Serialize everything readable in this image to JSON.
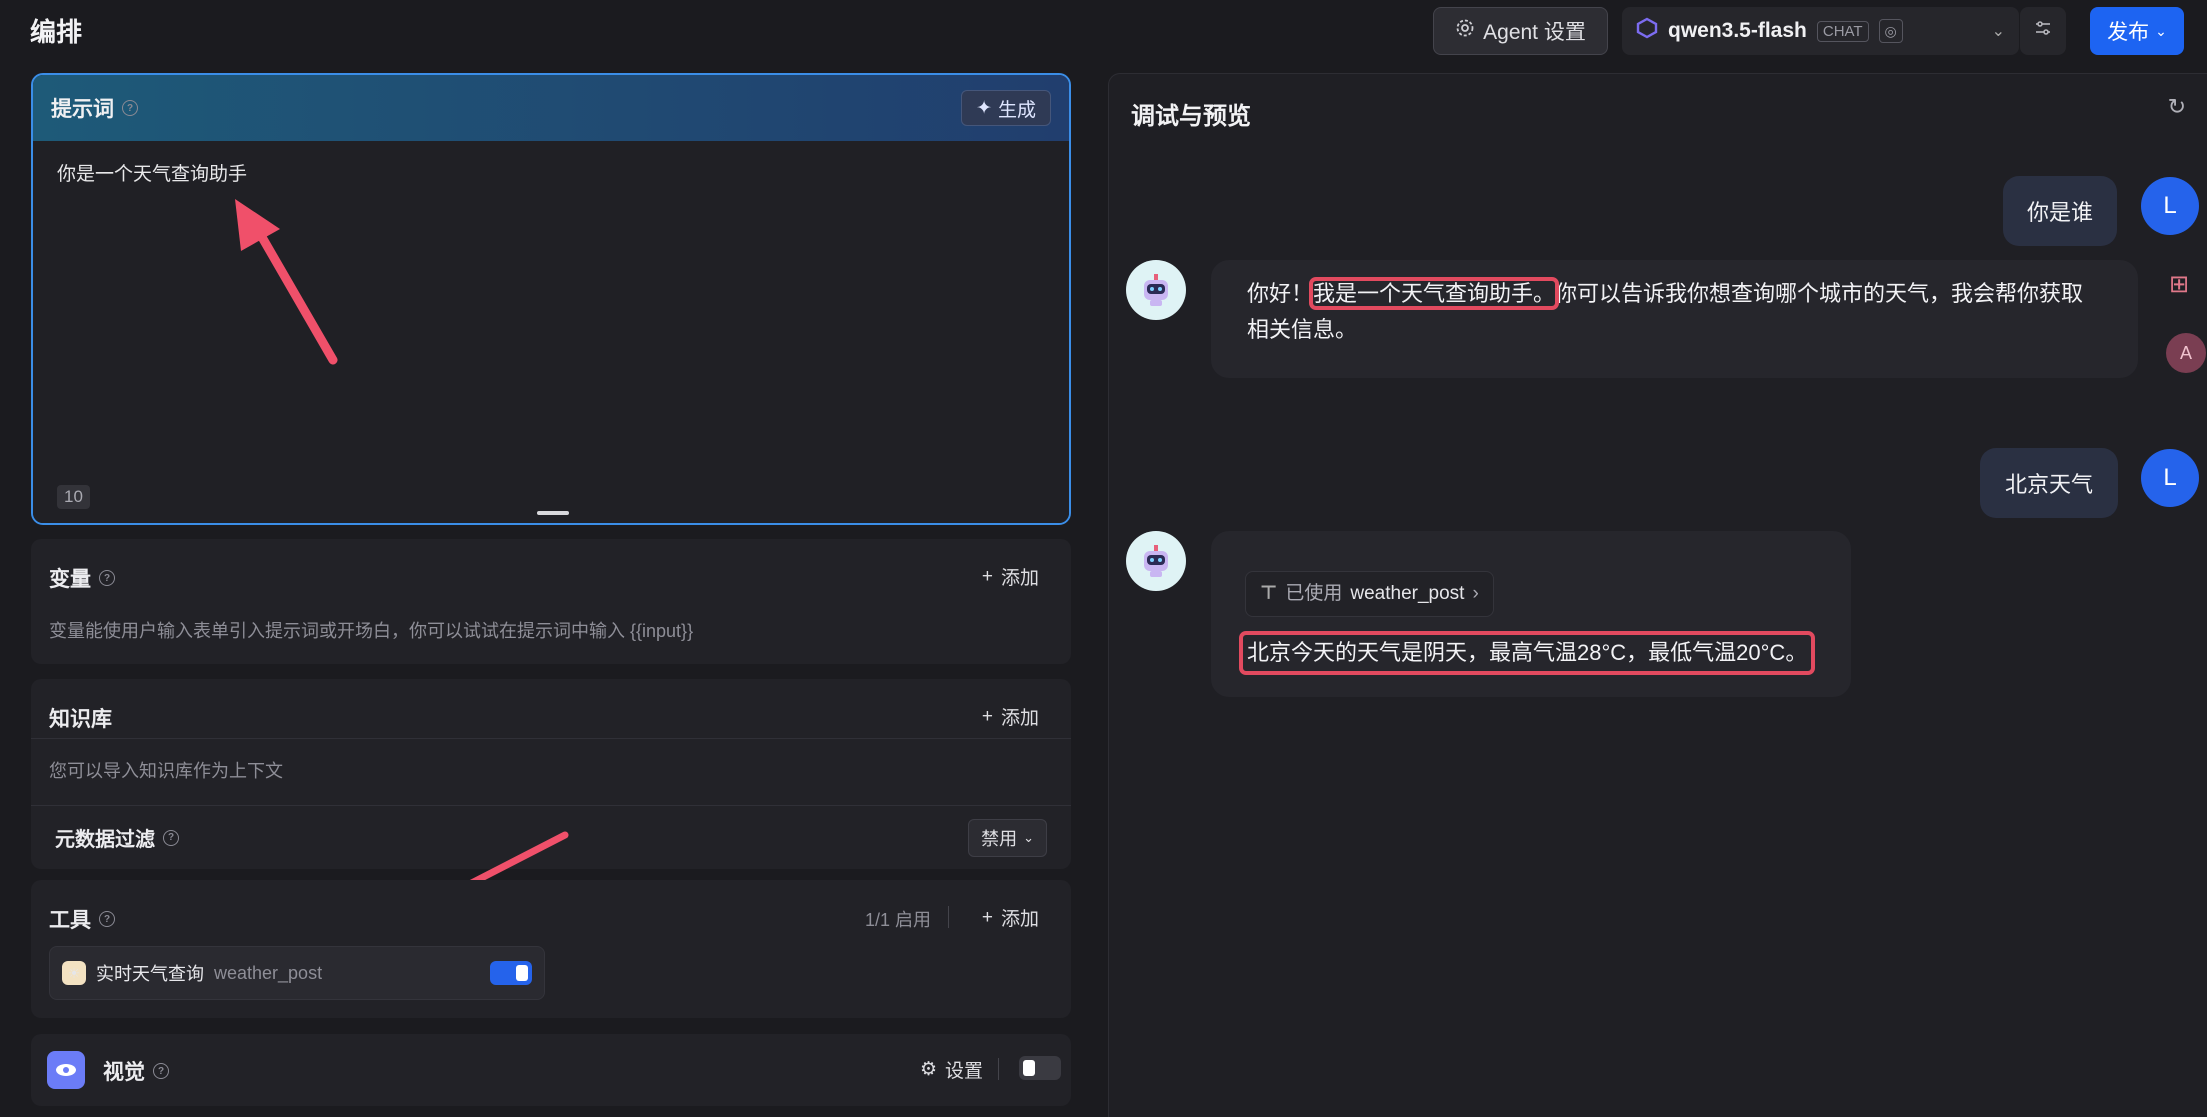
{
  "header": {
    "title": "编排",
    "agent_settings_label": "Agent 设置",
    "model_name": "qwen3.5-flash",
    "model_badge": "CHAT",
    "publish_label": "发布"
  },
  "prompt": {
    "label": "提示词",
    "generate_label": "生成",
    "text": "你是一个天气查询助手",
    "char_count": "10"
  },
  "variables": {
    "label": "变量",
    "add_label": "添加",
    "description": "变量能使用户输入表单引入提示词或开场白，你可以试试在提示词中输入 {{input}}"
  },
  "knowledge": {
    "label": "知识库",
    "add_label": "添加",
    "description": "您可以导入知识库作为上下文",
    "metadata_filter_label": "元数据过滤",
    "metadata_filter_value": "禁用"
  },
  "tools": {
    "label": "工具",
    "enabled_count": "1/1 启用",
    "add_label": "添加",
    "items": [
      {
        "label": "实时天气查询",
        "name": "weather_post",
        "enabled": true
      }
    ]
  },
  "vision": {
    "label": "视觉",
    "settings_label": "设置",
    "enabled": false
  },
  "preview": {
    "title": "调试与预览",
    "user_initial": "L",
    "messages": [
      {
        "role": "user",
        "text": "你是谁"
      },
      {
        "role": "bot",
        "text_before": "你好！",
        "text_highlight": "我是一个天气查询助手。",
        "text_after": "你可以告诉我你想查询哪个城市的天气，我会帮你获取",
        "text_line2": "相关信息。"
      },
      {
        "role": "user",
        "text": "北京天气"
      },
      {
        "role": "bot",
        "tool_used_label": "已使用",
        "tool_used_name": "weather_post",
        "text": "北京今天的天气是阴天，最高气温28°C，最低气温20°C。"
      }
    ]
  },
  "colors": {
    "accent_blue": "#1d64f2",
    "highlight_red": "#e24a5f",
    "annotation_arrow": "#f0506a"
  }
}
